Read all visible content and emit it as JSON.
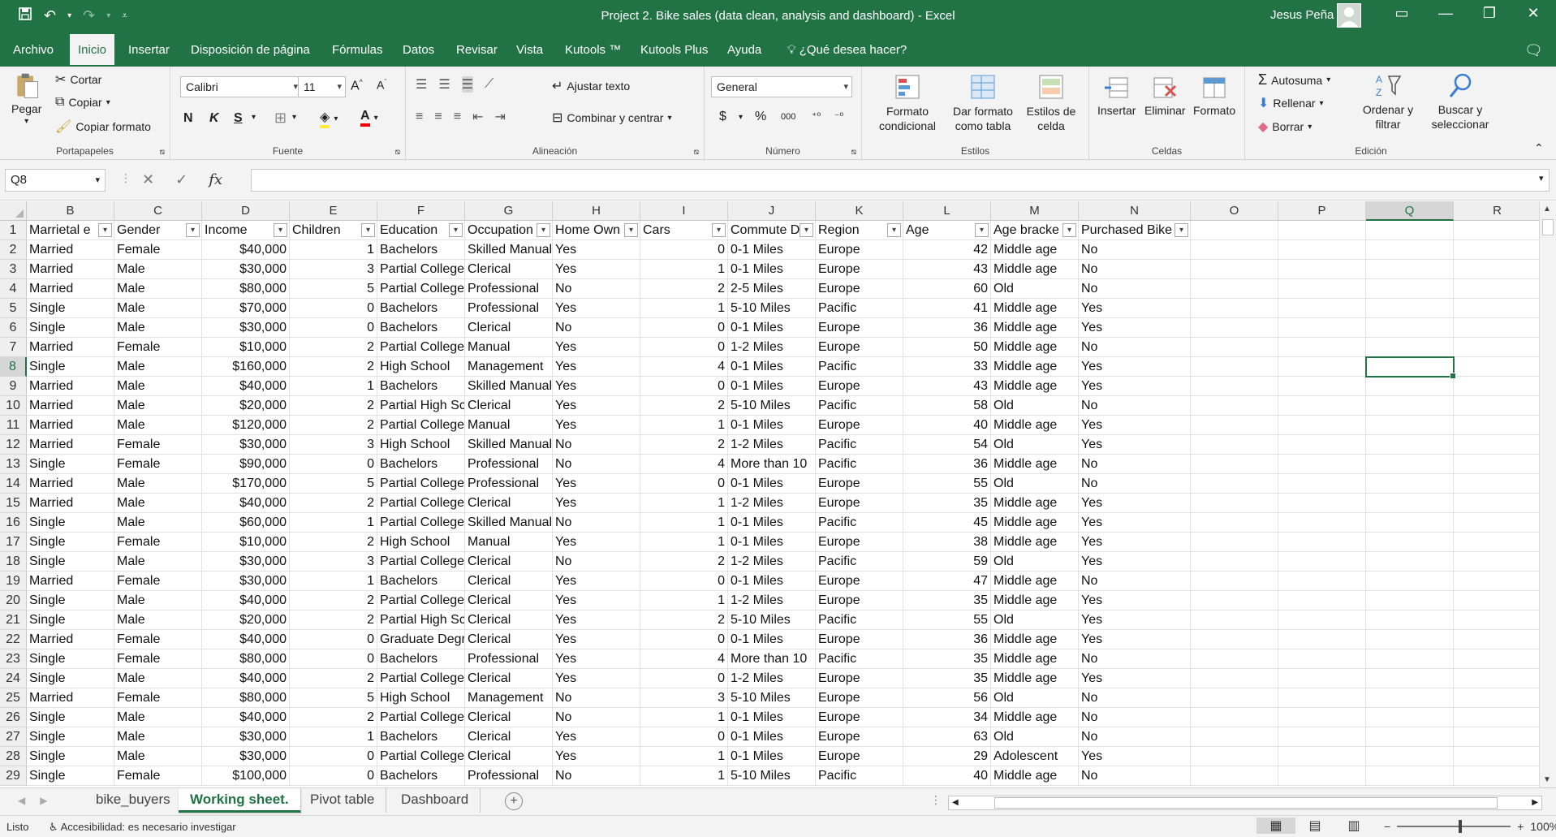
{
  "window": {
    "title": "Project 2. Bike sales (data clean, analysis and dashboard)  -  Excel",
    "user": "Jesus Peña"
  },
  "ribbon_tabs": [
    "Archivo",
    "Inicio",
    "Insertar",
    "Disposición de página",
    "Fórmulas",
    "Datos",
    "Revisar",
    "Vista",
    "Kutools ™",
    "Kutools Plus",
    "Ayuda"
  ],
  "active_tab": "Inicio",
  "tell_me": "¿Qué desea hacer?",
  "ribbon": {
    "portapapeles": {
      "label": "Portapapeles",
      "pegar": "Pegar",
      "cortar": "Cortar",
      "copiar": "Copiar",
      "copiar_formato": "Copiar formato"
    },
    "fuente": {
      "label": "Fuente",
      "font_name": "Calibri",
      "font_size": "11",
      "bold": "N",
      "italic": "K",
      "underline": "S"
    },
    "alineacion": {
      "label": "Alineación",
      "ajustar": "Ajustar texto",
      "combinar": "Combinar y centrar"
    },
    "numero": {
      "label": "Número",
      "format": "General",
      "currency": "$",
      "percent": "%",
      "thousands": "000"
    },
    "estilos": {
      "label": "Estilos",
      "formato_condicional": "Formato condicional",
      "dar_formato": "Dar formato como tabla",
      "estilos_celda": "Estilos de celda"
    },
    "celdas": {
      "label": "Celdas",
      "insertar": "Insertar",
      "eliminar": "Eliminar",
      "formato": "Formato"
    },
    "edicion": {
      "label": "Edición",
      "autosuma": "Autosuma",
      "rellenar": "Rellenar",
      "borrar": "Borrar",
      "ordenar": "Ordenar y filtrar",
      "buscar": "Buscar y seleccionar"
    }
  },
  "formula_bar": {
    "name_box": "Q8",
    "fx": "fx",
    "value": ""
  },
  "columns": [
    "B",
    "C",
    "D",
    "E",
    "F",
    "G",
    "H",
    "I",
    "J",
    "K",
    "L",
    "M",
    "N",
    "O",
    "P",
    "Q",
    "R"
  ],
  "selected_column": "Q",
  "selected_row": 8,
  "headers": [
    "Marrietal e",
    "Gender",
    "Income",
    "Children",
    "Education",
    "Occupation",
    "Home Own",
    "Cars",
    "Commute D",
    "Region",
    "Age",
    "Age bracke",
    "Purchased Bike"
  ],
  "rows": [
    [
      "Married",
      "Female",
      "$40,000",
      "1",
      "Bachelors",
      "Skilled Manual",
      "Yes",
      "0",
      "0-1 Miles",
      "Europe",
      "42",
      "Middle age",
      "No"
    ],
    [
      "Married",
      "Male",
      "$30,000",
      "3",
      "Partial College",
      "Clerical",
      "Yes",
      "1",
      "0-1 Miles",
      "Europe",
      "43",
      "Middle age",
      "No"
    ],
    [
      "Married",
      "Male",
      "$80,000",
      "5",
      "Partial College",
      "Professional",
      "No",
      "2",
      "2-5 Miles",
      "Europe",
      "60",
      "Old",
      "No"
    ],
    [
      "Single",
      "Male",
      "$70,000",
      "0",
      "Bachelors",
      "Professional",
      "Yes",
      "1",
      "5-10 Miles",
      "Pacific",
      "41",
      "Middle age",
      "Yes"
    ],
    [
      "Single",
      "Male",
      "$30,000",
      "0",
      "Bachelors",
      "Clerical",
      "No",
      "0",
      "0-1 Miles",
      "Europe",
      "36",
      "Middle age",
      "Yes"
    ],
    [
      "Married",
      "Female",
      "$10,000",
      "2",
      "Partial College",
      "Manual",
      "Yes",
      "0",
      "1-2 Miles",
      "Europe",
      "50",
      "Middle age",
      "No"
    ],
    [
      "Single",
      "Male",
      "$160,000",
      "2",
      "High School",
      "Management",
      "Yes",
      "4",
      "0-1 Miles",
      "Pacific",
      "33",
      "Middle age",
      "Yes"
    ],
    [
      "Married",
      "Male",
      "$40,000",
      "1",
      "Bachelors",
      "Skilled Manual",
      "Yes",
      "0",
      "0-1 Miles",
      "Europe",
      "43",
      "Middle age",
      "Yes"
    ],
    [
      "Married",
      "Male",
      "$20,000",
      "2",
      "Partial High Sc",
      "Clerical",
      "Yes",
      "2",
      "5-10 Miles",
      "Pacific",
      "58",
      "Old",
      "No"
    ],
    [
      "Married",
      "Male",
      "$120,000",
      "2",
      "Partial College",
      "Manual",
      "Yes",
      "1",
      "0-1 Miles",
      "Europe",
      "40",
      "Middle age",
      "Yes"
    ],
    [
      "Married",
      "Female",
      "$30,000",
      "3",
      "High School",
      "Skilled Manual",
      "No",
      "2",
      "1-2 Miles",
      "Pacific",
      "54",
      "Old",
      "Yes"
    ],
    [
      "Single",
      "Female",
      "$90,000",
      "0",
      "Bachelors",
      "Professional",
      "No",
      "4",
      "More than 10",
      "Pacific",
      "36",
      "Middle age",
      "No"
    ],
    [
      "Married",
      "Male",
      "$170,000",
      "5",
      "Partial College",
      "Professional",
      "Yes",
      "0",
      "0-1 Miles",
      "Europe",
      "55",
      "Old",
      "No"
    ],
    [
      "Married",
      "Male",
      "$40,000",
      "2",
      "Partial College",
      "Clerical",
      "Yes",
      "1",
      "1-2 Miles",
      "Europe",
      "35",
      "Middle age",
      "Yes"
    ],
    [
      "Single",
      "Male",
      "$60,000",
      "1",
      "Partial College",
      "Skilled Manual",
      "No",
      "1",
      "0-1 Miles",
      "Pacific",
      "45",
      "Middle age",
      "Yes"
    ],
    [
      "Single",
      "Female",
      "$10,000",
      "2",
      "High School",
      "Manual",
      "Yes",
      "1",
      "0-1 Miles",
      "Europe",
      "38",
      "Middle age",
      "Yes"
    ],
    [
      "Single",
      "Male",
      "$30,000",
      "3",
      "Partial College",
      "Clerical",
      "No",
      "2",
      "1-2 Miles",
      "Pacific",
      "59",
      "Old",
      "Yes"
    ],
    [
      "Married",
      "Female",
      "$30,000",
      "1",
      "Bachelors",
      "Clerical",
      "Yes",
      "0",
      "0-1 Miles",
      "Europe",
      "47",
      "Middle age",
      "No"
    ],
    [
      "Single",
      "Male",
      "$40,000",
      "2",
      "Partial College",
      "Clerical",
      "Yes",
      "1",
      "1-2 Miles",
      "Europe",
      "35",
      "Middle age",
      "Yes"
    ],
    [
      "Single",
      "Male",
      "$20,000",
      "2",
      "Partial High Sc",
      "Clerical",
      "Yes",
      "2",
      "5-10 Miles",
      "Pacific",
      "55",
      "Old",
      "Yes"
    ],
    [
      "Married",
      "Female",
      "$40,000",
      "0",
      "Graduate Degr",
      "Clerical",
      "Yes",
      "0",
      "0-1 Miles",
      "Europe",
      "36",
      "Middle age",
      "Yes"
    ],
    [
      "Single",
      "Female",
      "$80,000",
      "0",
      "Bachelors",
      "Professional",
      "Yes",
      "4",
      "More than 10",
      "Pacific",
      "35",
      "Middle age",
      "No"
    ],
    [
      "Single",
      "Male",
      "$40,000",
      "2",
      "Partial College",
      "Clerical",
      "Yes",
      "0",
      "1-2 Miles",
      "Europe",
      "35",
      "Middle age",
      "Yes"
    ],
    [
      "Married",
      "Female",
      "$80,000",
      "5",
      "High School",
      "Management",
      "No",
      "3",
      "5-10 Miles",
      "Europe",
      "56",
      "Old",
      "No"
    ],
    [
      "Single",
      "Male",
      "$40,000",
      "2",
      "Partial College",
      "Clerical",
      "No",
      "1",
      "0-1 Miles",
      "Europe",
      "34",
      "Middle age",
      "No"
    ],
    [
      "Single",
      "Male",
      "$30,000",
      "1",
      "Bachelors",
      "Clerical",
      "Yes",
      "0",
      "0-1 Miles",
      "Europe",
      "63",
      "Old",
      "No"
    ],
    [
      "Single",
      "Male",
      "$30,000",
      "0",
      "Partial College",
      "Clerical",
      "Yes",
      "1",
      "0-1 Miles",
      "Europe",
      "29",
      "Adolescent",
      "Yes"
    ],
    [
      "Single",
      "Female",
      "$100,000",
      "0",
      "Bachelors",
      "Professional",
      "No",
      "1",
      "5-10 Miles",
      "Pacific",
      "40",
      "Middle age",
      "No"
    ]
  ],
  "sheets": [
    "bike_buyers",
    "Working sheet.",
    "Pivot table",
    "Dashboard"
  ],
  "active_sheet": "Working sheet.",
  "status": {
    "ready": "Listo",
    "accessibility": "Accesibilidad: es necesario investigar",
    "zoom": "100%"
  },
  "colors": {
    "excel_green": "#217346"
  }
}
